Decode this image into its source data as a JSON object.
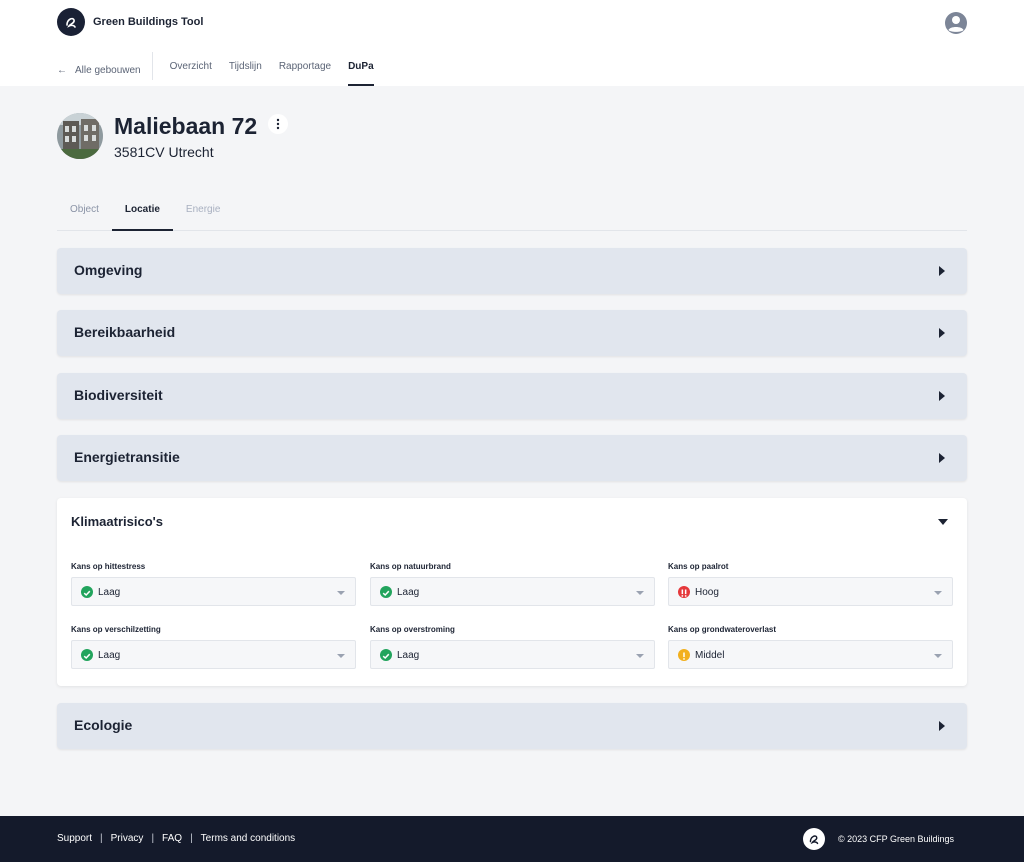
{
  "app": {
    "name": "Green Buildings Tool"
  },
  "nav": {
    "back_label": "Alle gebouwen",
    "items": [
      {
        "label": "Overzicht",
        "active": false
      },
      {
        "label": "Tijdslijn",
        "active": false
      },
      {
        "label": "Rapportage",
        "active": false
      },
      {
        "label": "DuPa",
        "active": true
      }
    ]
  },
  "building": {
    "title": "Maliebaan 72",
    "subtitle": "3581CV Utrecht"
  },
  "subtabs": [
    {
      "label": "Object",
      "state": "inactive"
    },
    {
      "label": "Locatie",
      "state": "active"
    },
    {
      "label": "Energie",
      "state": "disabled"
    }
  ],
  "sections": {
    "omgeving": "Omgeving",
    "bereikbaarheid": "Bereikbaarheid",
    "biodiversiteit": "Biodiversiteit",
    "energietransitie": "Energietransitie",
    "klimaatrisicos": "Klimaatrisico's",
    "ecologie": "Ecologie"
  },
  "klimaat": {
    "fields": [
      {
        "label": "Kans op hittestress",
        "value": "Laag",
        "status": "ok"
      },
      {
        "label": "Kans op natuurbrand",
        "value": "Laag",
        "status": "ok"
      },
      {
        "label": "Kans op paalrot",
        "value": "Hoog",
        "status": "high"
      },
      {
        "label": "Kans op verschilzetting",
        "value": "Laag",
        "status": "ok"
      },
      {
        "label": "Kans op overstroming",
        "value": "Laag",
        "status": "ok"
      },
      {
        "label": "Kans op grondwateroverlast",
        "value": "Middel",
        "status": "medium"
      }
    ]
  },
  "colors": {
    "ok": "#22a45d",
    "high": "#e5383b",
    "medium": "#f2b01e",
    "accordion": "#e1e6ee",
    "footer": "#141a2b"
  },
  "footer": {
    "links": [
      "Support",
      "Privacy",
      "FAQ",
      "Terms and conditions"
    ],
    "copyright": "© 2023 CFP Green Buildings"
  }
}
